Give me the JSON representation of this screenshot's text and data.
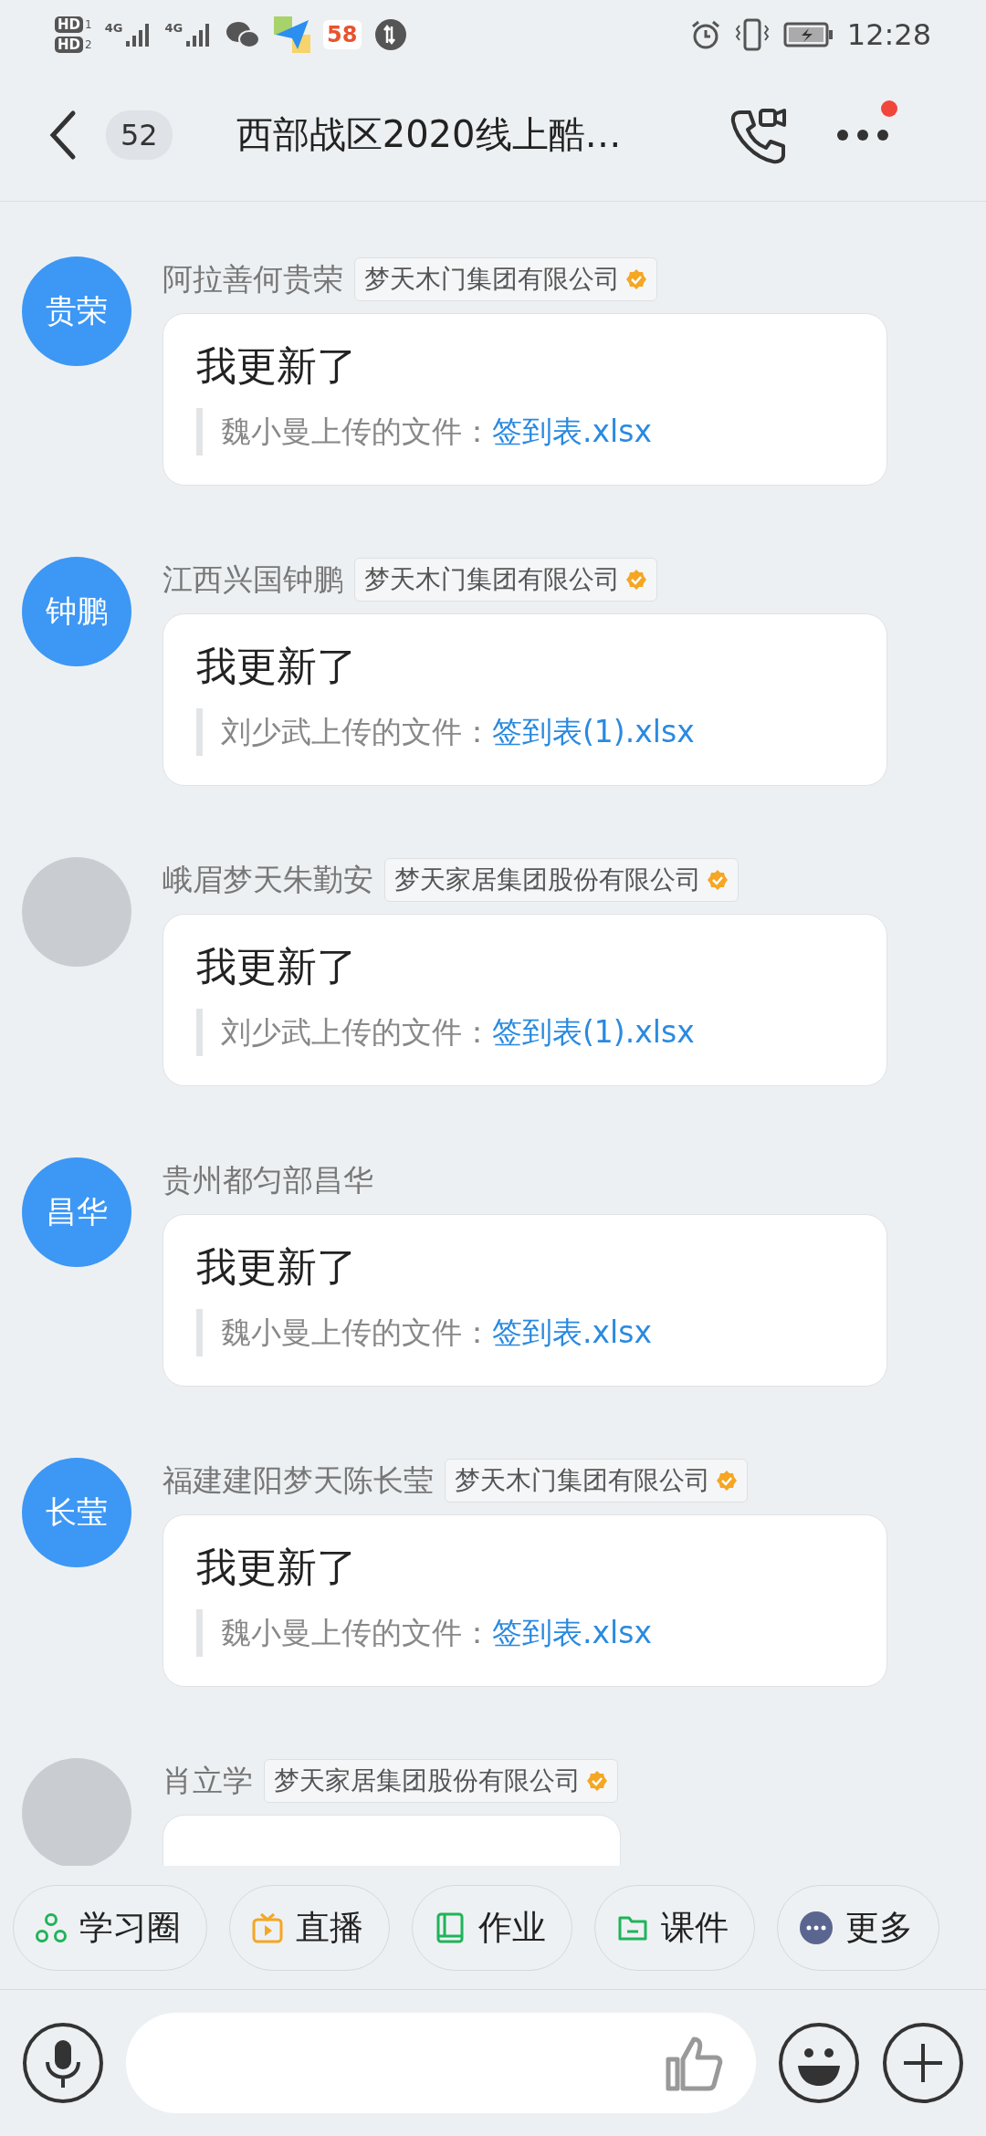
{
  "status_bar": {
    "sims": [
      {
        "badge": "HD",
        "index": "1"
      },
      {
        "badge": "HD",
        "index": "2"
      }
    ],
    "signals": [
      {
        "net": "4G"
      },
      {
        "net": "4G"
      }
    ],
    "app_badge": "58",
    "time": "12:28"
  },
  "header": {
    "unread_count": "52",
    "title": "西部战区2020线上酷…",
    "more_has_notice": true
  },
  "messages": [
    {
      "avatar": {
        "kind": "text",
        "label": "贵荣",
        "color": "#3d97f5"
      },
      "sender": "阿拉善何贵荣",
      "company": "梦天木门集团有限公司",
      "verified": true,
      "body": {
        "kind": "file_update",
        "text": "我更新了",
        "uploader": "魏小曼上传的文件：",
        "file": "签到表.xlsx"
      }
    },
    {
      "avatar": {
        "kind": "text",
        "label": "钟鹏",
        "color": "#3d97f5"
      },
      "sender": "江西兴国钟鹏",
      "company": "梦天木门集团有限公司",
      "verified": true,
      "body": {
        "kind": "file_update",
        "text": "我更新了",
        "uploader": "刘少武上传的文件：",
        "file": "签到表(1).xlsx"
      }
    },
    {
      "avatar": {
        "kind": "photo"
      },
      "sender": "峨眉梦天朱勤安",
      "company": "梦天家居集团股份有限公司",
      "verified": true,
      "body": {
        "kind": "file_update",
        "text": "我更新了",
        "uploader": "刘少武上传的文件：",
        "file": "签到表(1).xlsx"
      }
    },
    {
      "avatar": {
        "kind": "text",
        "label": "昌华",
        "color": "#3d97f5"
      },
      "sender": "贵州都匀部昌华",
      "body": {
        "kind": "file_update",
        "text": "我更新了",
        "uploader": "魏小曼上传的文件：",
        "file": "签到表.xlsx"
      }
    },
    {
      "avatar": {
        "kind": "text",
        "label": "长莹",
        "color": "#3d97f5"
      },
      "sender": "福建建阳梦天陈长莹",
      "company": "梦天木门集团有限公司",
      "verified": true,
      "body": {
        "kind": "file_update",
        "text": "我更新了",
        "uploader": "魏小曼上传的文件：",
        "file": "签到表.xlsx"
      }
    },
    {
      "avatar": {
        "kind": "photo"
      },
      "sender": "肖立学",
      "company": "梦天家居集团股份有限公司",
      "verified": true,
      "body": {
        "kind": "cut_off"
      }
    }
  ],
  "shortcuts": [
    {
      "label": "学习圈",
      "kind": "circle",
      "color": "#1fb45a"
    },
    {
      "label": "直播",
      "kind": "tv",
      "color": "#f5a623"
    },
    {
      "label": "作业",
      "kind": "book",
      "color": "#1fb45a"
    },
    {
      "label": "课件",
      "kind": "folder",
      "color": "#1fb45a"
    },
    {
      "label": "更多",
      "kind": "more",
      "color": "#5a6590"
    }
  ]
}
